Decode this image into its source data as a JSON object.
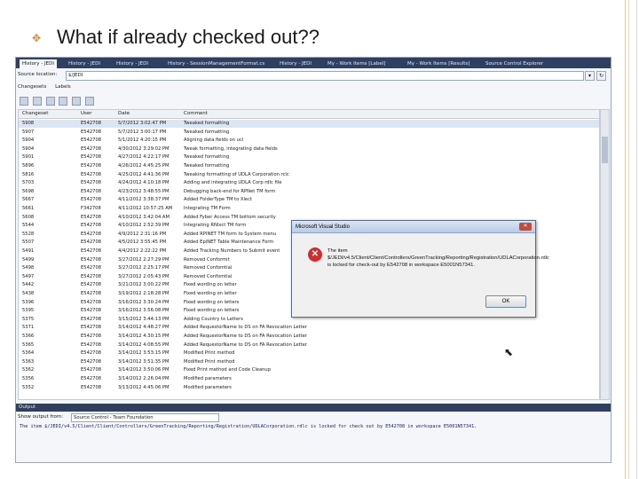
{
  "slide": {
    "bullet_icon": "diamond-bullet-icon",
    "title": "What if already checked out??"
  },
  "tabs": [
    "History - JEDI",
    "History - JEDI",
    "History - JEDI",
    "History - SessionManagementFormat.cs",
    "History - JEDI",
    "My - Work Items [Label]",
    "My - Work Items [Results]",
    "Source Control Explorer"
  ],
  "location": {
    "label": "Source location:",
    "value": "$/JEDI"
  },
  "subtabs": [
    "Changesets",
    "Labels"
  ],
  "columns": [
    "Changeset",
    "User",
    "Date",
    "Comment"
  ],
  "rows": [
    [
      "5908",
      "E542708",
      "5/7/2012 3:02:47 PM",
      "Tweaked formatting"
    ],
    [
      "5907",
      "E542708",
      "5/7/2012 3:00:17 PM",
      "Tweaked formatting"
    ],
    [
      "5904",
      "E542708",
      "5/1/2012 4:20:15 PM",
      "Aligning data fields on ucl"
    ],
    [
      "5904",
      "E542708",
      "4/30/2012 3:29:02 PM",
      "Tweak formatting, integrating data fields"
    ],
    [
      "5901",
      "E542708",
      "4/27/2012 4:22:17 PM",
      "Tweaked formatting"
    ],
    [
      "5896",
      "E542708",
      "4/26/2012 4:45:25 PM",
      "Tweaked formatting"
    ],
    [
      "5816",
      "E542708",
      "4/25/2012 4:41:36 PM",
      "Tweaking formatting of UDLA Corporation rclc"
    ],
    [
      "5703",
      "E542708",
      "4/24/2012 4:10:18 PM",
      "Adding and integrating UDLA Corp rdlc file"
    ],
    [
      "5698",
      "E542708",
      "4/23/2012 3:48:55 PM",
      "Debugging back-end for RPNet TM form"
    ],
    [
      "5667",
      "E542708",
      "4/11/2012 3:38:37 PM",
      "Added FolderType TM to Xlect"
    ],
    [
      "5661",
      "F342708",
      "4/11/2012 10:57:25 AM",
      "Integrating TM Form"
    ],
    [
      "5608",
      "E542708",
      "4/10/2012 3:42:04 AM",
      "Added Fyber Access TM bottom security"
    ],
    [
      "5544",
      "E542708",
      "4/10/2012 2:52:39 PM",
      "Integrating RNIxct TM form"
    ],
    [
      "5528",
      "E542708",
      "4/9/2012 2:31:16 PM",
      "Added RPINET TM form to System menu"
    ],
    [
      "5507",
      "E542708",
      "4/5/2012 3:55:45 PM",
      "Added EpiNET Table Maintenance Form"
    ],
    [
      "5491",
      "E542708",
      "4/4/2012 2:22:22 PM",
      "Added Tracking Numbers to Submit event"
    ],
    [
      "5499",
      "E542708",
      "3/27/2012 2:27:29 PM",
      "Removed Conformit"
    ],
    [
      "5498",
      "E542708",
      "3/27/2012 2:25:17 PM",
      "Removed Confomtial"
    ],
    [
      "5497",
      "E542708",
      "3/27/2012 2:05:43 PM",
      "Removed Confomtial"
    ],
    [
      "5442",
      "E542708",
      "3/21/2012 3:00:22 PM",
      "Fixed wording on letter"
    ],
    [
      "5438",
      "E542708",
      "3/19/2012 2:18:28 PM",
      "Fixed wording on letter"
    ],
    [
      "5396",
      "E542708",
      "3/16/2012 3:30:24 PM",
      "Fixed wording on letters"
    ],
    [
      "5395",
      "E542708",
      "3/16/2012 3:56:08 PM",
      "Fixed wording on letters"
    ],
    [
      "5375",
      "E542708",
      "3/15/2012 3:44:13 PM",
      "Adding Country to Letters"
    ],
    [
      "5371",
      "E542708",
      "3/14/2012 4:48:27 PM",
      "Added RequestorName to DS on FA Revocation Letter"
    ],
    [
      "5366",
      "E542708",
      "3/14/2012 4:30:15 PM",
      "Added RequestorName to DS on FA Revocation Letter"
    ],
    [
      "5365",
      "E542708",
      "3/14/2012 4:08:55 PM",
      "Added RequestorName to DS on FA Revocation Letter"
    ],
    [
      "5364",
      "E542708",
      "3/14/2012 3:53:15 PM",
      "Modified Print method"
    ],
    [
      "5363",
      "E542708",
      "3/14/2012 3:51:35 PM",
      "Modified Print method"
    ],
    [
      "5362",
      "E542708",
      "3/14/2012 3:50:06 PM",
      "Fixed Print method and Code Cleanup"
    ],
    [
      "5356",
      "E542708",
      "3/14/2012 2:26:04 PM",
      "Modified parameters"
    ],
    [
      "5352",
      "E542708",
      "3/13/2012 4:45:06 PM",
      "Modified parameters"
    ]
  ],
  "output": {
    "title": "Output",
    "show_from_label": "Show output from:",
    "show_from_value": "Source Control - Team Foundation",
    "message": "The item $/JEDI/v4.5/Client/Client/Controllers/GreenTracking/Reporting/Registration/UDLACorporation.rdlc is locked for check out by E542708 in workspace E5001N57341."
  },
  "dialog": {
    "title": "Microsoft Visual Studio",
    "close": "✕",
    "icon": "error-icon",
    "message": "The item $/JEDI/v4.5/Client/Client/Controllers/GreenTracking/Reporting/Registration/UDLACorporation.rdlc is locked for check-out by E542708 in workspace E5001N57341.",
    "ok_label": "OK"
  }
}
